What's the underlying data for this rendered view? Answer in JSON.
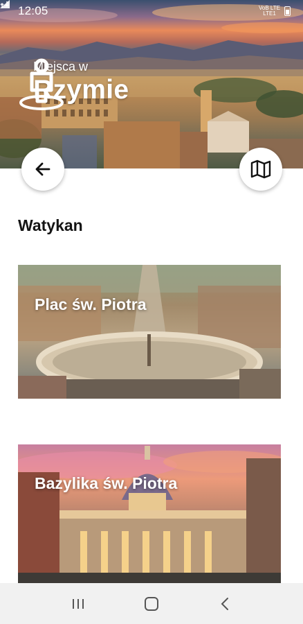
{
  "status_bar": {
    "time": "12:05",
    "notification_icon": "sync-icon",
    "network_top": "VoB LTE",
    "network_bottom": "LTE1",
    "icons": [
      "lte-signal-icon",
      "cell-signal-icon",
      "battery-icon"
    ]
  },
  "hero": {
    "subtitle": "Miejsca w",
    "title": "Rzymie",
    "logo_icon": "location-pin-person-icon"
  },
  "actions": {
    "back_icon": "arrow-left-icon",
    "map_icon": "map-icon"
  },
  "section": {
    "title": "Watykan"
  },
  "cards": [
    {
      "title": "Plac św. Piotra",
      "image": "st-peters-square-photo"
    },
    {
      "title": "Bazylika św. Piotra",
      "image": "st-peters-basilica-photo"
    }
  ],
  "nav_bar": {
    "recents_icon": "recents-icon",
    "home_icon": "home-icon",
    "back_icon": "back-chevron-icon"
  }
}
